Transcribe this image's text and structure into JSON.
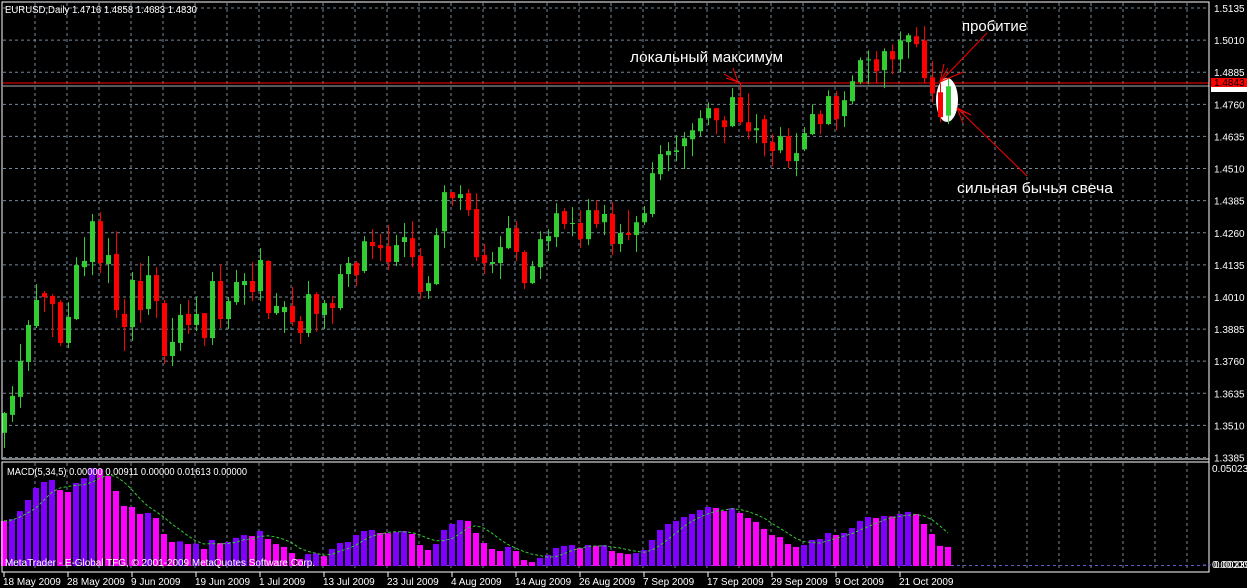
{
  "header": {
    "symbol": "EURUSD,Daily",
    "open": "1.4716",
    "high": "1.4858",
    "low": "1.4683",
    "close": "1.4830"
  },
  "price_axis": {
    "labels": [
      "1.5135",
      "1.5010",
      "1.4885",
      "1.4760",
      "1.4635",
      "1.4510",
      "1.4385",
      "1.4260",
      "1.4135",
      "1.4010",
      "1.3885",
      "1.3760",
      "1.3635",
      "1.3510",
      "1.3385"
    ],
    "current_price_label": "1.4843"
  },
  "macd_panel": {
    "label": "MACD(5,34,5) 0.00000 0.00911 0.00000 0.01613 0.00000",
    "axis_top": "0.05023",
    "axis_bottom": "0.00239",
    "axis_bottom_overlap": "0.00000"
  },
  "copyright": "MetaTrader - E-Global TFG, © 2001-2009 MetaQuotes Software Corp.",
  "annotations": {
    "local_max": "локальный максимум",
    "breakout": "пробитие",
    "bull_candle": "сильная бычья свеча"
  },
  "colors": {
    "background": "#000000",
    "bull": "#32cd32",
    "bear": "#ff0000",
    "grid": "#778899",
    "macd_up": "#8000ff",
    "macd_down": "#ff00ff",
    "signal": "#32cd32",
    "price_line": "#ff0000"
  },
  "chart_data": {
    "type": "candlestick",
    "title": "EURUSD,Daily",
    "ylim": [
      1.3385,
      1.5135
    ],
    "grid": true,
    "current_price": 1.4843,
    "bid_price": 1.483,
    "x_labels": [
      "18 May 2009",
      "28 May 2009",
      "9 Jun 2009",
      "19 Jun 2009",
      "1 Jul 2009",
      "13 Jul 2009",
      "23 Jul 2009",
      "4 Aug 2009",
      "14 Aug 2009",
      "26 Aug 2009",
      "7 Sep 2009",
      "17 Sep 2009",
      "29 Sep 2009",
      "9 Oct 2009",
      "21 Oct 2009"
    ],
    "x_label_every": 8,
    "ohlc_fields": [
      "open",
      "high",
      "low",
      "close"
    ],
    "ohlc": [
      [
        1.3481,
        1.3562,
        1.3422,
        1.3558
      ],
      [
        1.3551,
        1.3663,
        1.3523,
        1.3625
      ],
      [
        1.3621,
        1.3827,
        1.3578,
        1.3761
      ],
      [
        1.3757,
        1.392,
        1.3722,
        1.3901
      ],
      [
        1.3897,
        1.406,
        1.3889,
        1.3998
      ],
      [
        1.4025,
        1.4033,
        1.3951,
        1.401
      ],
      [
        1.4014,
        1.4021,
        1.3854,
        1.3982
      ],
      [
        1.399,
        1.3998,
        1.3819,
        1.3831
      ],
      [
        1.3831,
        1.399,
        1.3811,
        1.3932
      ],
      [
        1.3924,
        1.4165,
        1.392,
        1.4134
      ],
      [
        1.4126,
        1.4243,
        1.4091,
        1.415
      ],
      [
        1.4146,
        1.4333,
        1.4095,
        1.4305
      ],
      [
        1.4305,
        1.434,
        1.4103,
        1.4142
      ],
      [
        1.4138,
        1.4239,
        1.4064,
        1.4173
      ],
      [
        1.4177,
        1.4266,
        1.3928,
        1.3959
      ],
      [
        1.3944,
        1.4002,
        1.38,
        1.3893
      ],
      [
        1.3893,
        1.4107,
        1.3839,
        1.4076
      ],
      [
        1.4072,
        1.4142,
        1.3909,
        1.3959
      ],
      [
        1.3963,
        1.4169,
        1.394,
        1.4095
      ],
      [
        1.4095,
        1.4126,
        1.3928,
        1.3994
      ],
      [
        1.3986,
        1.3998,
        1.3749,
        1.378
      ],
      [
        1.378,
        1.3928,
        1.3741,
        1.3835
      ],
      [
        1.3831,
        1.3982,
        1.38,
        1.394
      ],
      [
        1.3944,
        1.3998,
        1.3866,
        1.3901
      ],
      [
        1.3901,
        1.401,
        1.3877,
        1.3944
      ],
      [
        1.3947,
        1.3947,
        1.3819,
        1.385
      ],
      [
        1.385,
        1.4107,
        1.3823,
        1.4072
      ],
      [
        1.4072,
        1.4138,
        1.3889,
        1.3924
      ],
      [
        1.3924,
        1.401,
        1.3885,
        1.3994
      ],
      [
        1.399,
        1.4115,
        1.3979,
        1.4068
      ],
      [
        1.4056,
        1.4103,
        1.3979,
        1.4072
      ],
      [
        1.4072,
        1.4146,
        1.3994,
        1.4029
      ],
      [
        1.4033,
        1.42,
        1.3994,
        1.4154
      ],
      [
        1.415,
        1.4154,
        1.3924,
        1.3947
      ],
      [
        1.3947,
        1.4025,
        1.394,
        1.3975
      ],
      [
        1.3951,
        1.3994,
        1.387,
        1.3971
      ],
      [
        1.3975,
        1.4049,
        1.3897,
        1.3912
      ],
      [
        1.3916,
        1.3936,
        1.3827,
        1.387
      ],
      [
        1.387,
        1.4072,
        1.3854,
        1.4021
      ],
      [
        1.4021,
        1.4029,
        1.3874,
        1.3944
      ],
      [
        1.394,
        1.3998,
        1.3885,
        1.3986
      ],
      [
        1.3986,
        1.4014,
        1.3905,
        1.3967
      ],
      [
        1.3967,
        1.4134,
        1.3959,
        1.4099
      ],
      [
        1.4099,
        1.4165,
        1.4049,
        1.4142
      ],
      [
        1.4142,
        1.415,
        1.4052,
        1.4095
      ],
      [
        1.4111,
        1.4247,
        1.4103,
        1.4227
      ],
      [
        1.4224,
        1.4274,
        1.4158,
        1.4208
      ],
      [
        1.4212,
        1.4255,
        1.415,
        1.42
      ],
      [
        1.4208,
        1.429,
        1.4115,
        1.4146
      ],
      [
        1.4146,
        1.4251,
        1.413,
        1.4212
      ],
      [
        1.4224,
        1.4298,
        1.4165,
        1.4243
      ],
      [
        1.4239,
        1.4305,
        1.4126,
        1.4165
      ],
      [
        1.4169,
        1.42,
        1.4002,
        1.4029
      ],
      [
        1.4033,
        1.4091,
        1.4002,
        1.4064
      ],
      [
        1.406,
        1.4278,
        1.4056,
        1.4251
      ],
      [
        1.4266,
        1.4445,
        1.42,
        1.4418
      ],
      [
        1.4418,
        1.4418,
        1.4364,
        1.4395
      ],
      [
        1.4395,
        1.4445,
        1.4348,
        1.441
      ],
      [
        1.4414,
        1.443,
        1.4325,
        1.4348
      ],
      [
        1.4352,
        1.4414,
        1.415,
        1.4165
      ],
      [
        1.4173,
        1.4216,
        1.4099,
        1.4142
      ],
      [
        1.4138,
        1.4185,
        1.4103,
        1.4146
      ],
      [
        1.4142,
        1.4247,
        1.408,
        1.4204
      ],
      [
        1.42,
        1.4325,
        1.4196,
        1.4278
      ],
      [
        1.4278,
        1.4305,
        1.415,
        1.4185
      ],
      [
        1.4185,
        1.4192,
        1.4041,
        1.4064
      ],
      [
        1.4064,
        1.415,
        1.406,
        1.413
      ],
      [
        1.4126,
        1.4266,
        1.408,
        1.4235
      ],
      [
        1.4227,
        1.4274,
        1.4189,
        1.4247
      ],
      [
        1.4243,
        1.4375,
        1.4204,
        1.4336
      ],
      [
        1.4344,
        1.4356,
        1.4274,
        1.4294
      ],
      [
        1.4294,
        1.436,
        1.4247,
        1.4298
      ],
      [
        1.4298,
        1.4348,
        1.42,
        1.4235
      ],
      [
        1.4235,
        1.4391,
        1.4212,
        1.4348
      ],
      [
        1.4348,
        1.4387,
        1.4278,
        1.4294
      ],
      [
        1.4301,
        1.4368,
        1.4251,
        1.4333
      ],
      [
        1.4333,
        1.4379,
        1.4173,
        1.4216
      ],
      [
        1.4216,
        1.4294,
        1.4185,
        1.4259
      ],
      [
        1.4259,
        1.4348,
        1.4231,
        1.4251
      ],
      [
        1.4251,
        1.4325,
        1.4185,
        1.4301
      ],
      [
        1.4301,
        1.4364,
        1.429,
        1.4336
      ],
      [
        1.4333,
        1.4535,
        1.4321,
        1.4492
      ],
      [
        1.4488,
        1.4601,
        1.4465,
        1.4566
      ],
      [
        1.4562,
        1.4613,
        1.45,
        1.4578
      ],
      [
        1.4574,
        1.464,
        1.4539,
        1.4581
      ],
      [
        1.4597,
        1.4652,
        1.4508,
        1.4628
      ],
      [
        1.4624,
        1.4687,
        1.4558,
        1.4659
      ],
      [
        1.4655,
        1.4737,
        1.4636,
        1.4706
      ],
      [
        1.4706,
        1.4768,
        1.4679,
        1.4745
      ],
      [
        1.4745,
        1.4745,
        1.4644,
        1.4698
      ],
      [
        1.4698,
        1.4714,
        1.4609,
        1.4671
      ],
      [
        1.4675,
        1.4823,
        1.4671,
        1.4788
      ],
      [
        1.4788,
        1.4842,
        1.4679,
        1.469
      ],
      [
        1.469,
        1.4803,
        1.4624,
        1.4655
      ],
      [
        1.4659,
        1.4722,
        1.4609,
        1.4667
      ],
      [
        1.4702,
        1.4718,
        1.4558,
        1.4609
      ],
      [
        1.4613,
        1.4644,
        1.4519,
        1.4578
      ],
      [
        1.4581,
        1.4671,
        1.457,
        1.4636
      ],
      [
        1.4636,
        1.4667,
        1.4512,
        1.4539
      ],
      [
        1.4539,
        1.4648,
        1.448,
        1.457
      ],
      [
        1.4585,
        1.4671,
        1.4578,
        1.4648
      ],
      [
        1.4644,
        1.476,
        1.464,
        1.4722
      ],
      [
        1.4722,
        1.4737,
        1.4644,
        1.4683
      ],
      [
        1.4683,
        1.4815,
        1.4679,
        1.4792
      ],
      [
        1.4792,
        1.4811,
        1.4659,
        1.4702
      ],
      [
        1.4714,
        1.4811,
        1.4671,
        1.4776
      ],
      [
        1.4772,
        1.4873,
        1.476,
        1.485
      ],
      [
        1.4846,
        1.4943,
        1.4838,
        1.4932
      ],
      [
        1.4932,
        1.497,
        1.4838,
        1.4935
      ],
      [
        1.4935,
        1.4967,
        1.4842,
        1.4889
      ],
      [
        1.4893,
        1.4978,
        1.4823,
        1.4967
      ],
      [
        1.4967,
        1.4994,
        1.4877,
        1.4935
      ],
      [
        1.4935,
        1.5044,
        1.4885,
        1.5009
      ],
      [
        1.5002,
        1.5037,
        1.4939,
        1.5029
      ],
      [
        1.5025,
        1.506,
        1.4982,
        1.4994
      ],
      [
        1.5009,
        1.5064,
        1.4842,
        1.4862
      ],
      [
        1.4865,
        1.4928,
        1.4768,
        1.4803
      ],
      [
        1.4807,
        1.4842,
        1.469,
        1.471
      ],
      [
        1.4716,
        1.4858,
        1.4683,
        1.483
      ]
    ],
    "local_max_index": 92,
    "breakout_index": 116,
    "bull_candle_index": 118,
    "macd": {
      "name": "MACD(5,34,5)",
      "type": "bar",
      "ylim": [
        0.00239,
        0.05023
      ],
      "signal_period": 5,
      "values": [
        0.0244,
        0.0253,
        0.0292,
        0.0346,
        0.0405,
        0.0434,
        0.0444,
        0.0395,
        0.0385,
        0.0429,
        0.0453,
        0.0502,
        0.0497,
        0.0463,
        0.039,
        0.0317,
        0.0312,
        0.0278,
        0.0283,
        0.0258,
        0.018,
        0.0141,
        0.0144,
        0.0131,
        0.0133,
        0.0107,
        0.0151,
        0.0136,
        0.0141,
        0.0161,
        0.0175,
        0.017,
        0.0195,
        0.0156,
        0.0131,
        0.0117,
        0.0087,
        0.0058,
        0.0082,
        0.0085,
        0.0072,
        0.0107,
        0.0136,
        0.0141,
        0.0175,
        0.0195,
        0.02,
        0.0185,
        0.0184,
        0.019,
        0.0195,
        0.018,
        0.0126,
        0.0102,
        0.0131,
        0.02,
        0.0229,
        0.0248,
        0.0244,
        0.0185,
        0.0136,
        0.0107,
        0.0097,
        0.0117,
        0.0097,
        0.0053,
        0.0043,
        0.0063,
        0.0078,
        0.0112,
        0.0122,
        0.0126,
        0.0112,
        0.0126,
        0.0122,
        0.0126,
        0.0097,
        0.0087,
        0.0082,
        0.0087,
        0.0102,
        0.0151,
        0.02,
        0.0229,
        0.0244,
        0.0263,
        0.0278,
        0.0297,
        0.0312,
        0.0307,
        0.0292,
        0.0307,
        0.0283,
        0.0258,
        0.0239,
        0.0205,
        0.0175,
        0.0165,
        0.0131,
        0.0117,
        0.0126,
        0.0151,
        0.0156,
        0.0185,
        0.0175,
        0.0185,
        0.0209,
        0.0244,
        0.0263,
        0.0258,
        0.0268,
        0.0266,
        0.0278,
        0.0288,
        0.0278,
        0.0229,
        0.018,
        0.0122,
        0.0117
      ]
    }
  }
}
